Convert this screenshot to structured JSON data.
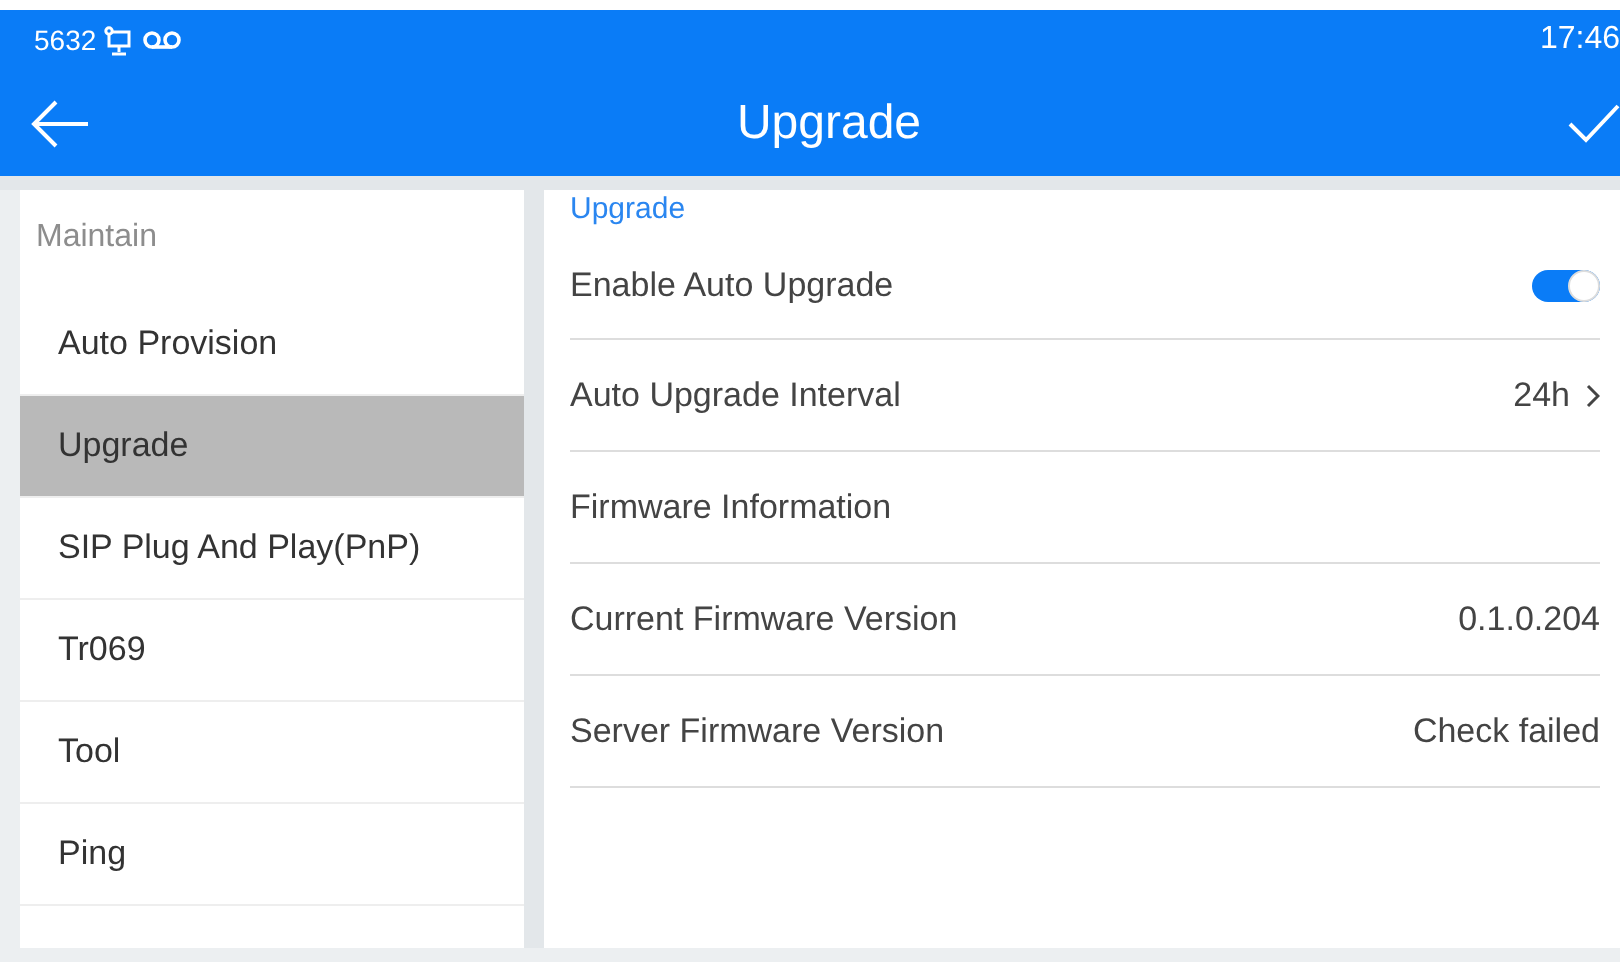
{
  "status_bar": {
    "extension": "5632",
    "time": "17:46"
  },
  "title_bar": {
    "title": "Upgrade"
  },
  "sidebar": {
    "header": "Maintain",
    "items": [
      {
        "label": "Auto Provision",
        "selected": false
      },
      {
        "label": "Upgrade",
        "selected": true
      },
      {
        "label": "SIP Plug And Play(PnP)",
        "selected": false
      },
      {
        "label": "Tr069",
        "selected": false
      },
      {
        "label": "Tool",
        "selected": false
      },
      {
        "label": "Ping",
        "selected": false
      }
    ]
  },
  "content": {
    "section": "Upgrade",
    "rows": [
      {
        "kind": "switch",
        "label": "Enable Auto Upgrade",
        "on": true
      },
      {
        "kind": "link",
        "label": "Auto Upgrade Interval",
        "value": "24h"
      },
      {
        "kind": "heading",
        "label": "Firmware Information"
      },
      {
        "kind": "value",
        "label": "Current Firmware Version",
        "value": "0.1.0.204"
      },
      {
        "kind": "value",
        "label": "Server Firmware Version",
        "value": "Check failed"
      }
    ]
  }
}
